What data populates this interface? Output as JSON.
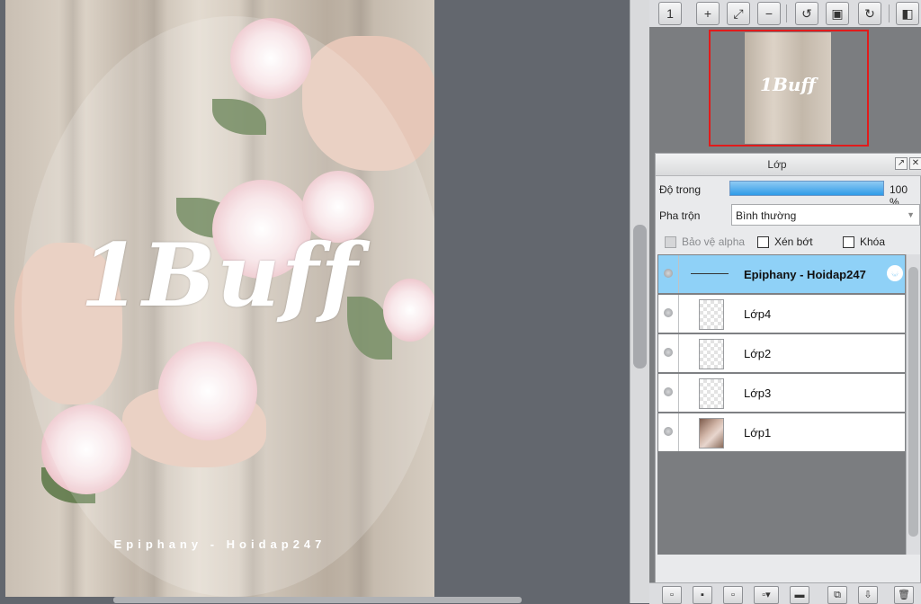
{
  "canvas": {
    "title_art": "1Buff",
    "credit": "Epiphany - Hoidap247"
  },
  "navigator": {
    "thumb_text": "1Buff"
  },
  "toolbar": {
    "icons": [
      "zoom-actual-icon",
      "zoom-in-icon",
      "fit-screen-icon",
      "zoom-out-icon",
      "rotate-left-icon",
      "reset-rotation-icon",
      "rotate-right-icon",
      "flip-icon"
    ],
    "glyphs": [
      "1",
      "+",
      "⤢",
      "−",
      "↺",
      "▣",
      "↻",
      "◧"
    ]
  },
  "layer_panel": {
    "title": "Lớp",
    "opacity_label": "Độ trong",
    "opacity_value": "100 %",
    "opacity_fraction": 1.0,
    "blend_label": "Pha trộn",
    "blend_value": "Bình thường",
    "protect_alpha_label": "Bảo vệ alpha",
    "clipping_label": "Xén bớt",
    "lock_label": "Khóa",
    "layers": [
      {
        "name": "Epiphany - Hoidap247",
        "selected": true,
        "thumb": "line"
      },
      {
        "name": "Lớp4",
        "selected": false,
        "thumb": "transparent"
      },
      {
        "name": "Lớp2",
        "selected": false,
        "thumb": "transparent"
      },
      {
        "name": "Lớp3",
        "selected": false,
        "thumb": "transparent"
      },
      {
        "name": "Lớp1",
        "selected": false,
        "thumb": "photo"
      }
    ]
  },
  "colors": {
    "selection": "#8fd1f7",
    "navigator_frame": "#e11b1b",
    "workspace": "#63676e"
  }
}
